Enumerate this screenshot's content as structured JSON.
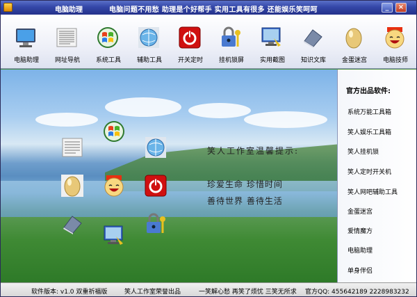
{
  "titlebar": {
    "title": "电脑助理",
    "slogan": "电脑问题不用愁  助理是个好帮手  实用工具有很多  还能娱乐笑呵呵",
    "minimize": "_",
    "close": "×"
  },
  "toolbar": {
    "items": [
      {
        "label": "电脑助理",
        "icon": "monitor-icon"
      },
      {
        "label": "网址导航",
        "icon": "document-icon"
      },
      {
        "label": "系统工具",
        "icon": "windows-logo-icon"
      },
      {
        "label": "辅助工具",
        "icon": "globe-icon"
      },
      {
        "label": "开关定时",
        "icon": "power-icon"
      },
      {
        "label": "挂机锁屏",
        "icon": "lock-key-icon"
      },
      {
        "label": "实用截图",
        "icon": "screen-capture-icon"
      },
      {
        "label": "知识文库",
        "icon": "book-icon"
      },
      {
        "label": "金蛋迷宫",
        "icon": "golden-egg-icon"
      },
      {
        "label": "电脑技师",
        "icon": "smiley-face-icon"
      }
    ]
  },
  "main": {
    "tip_title": "笑人工作室温馨提示:",
    "tip_line1": "珍爱生命   珍惜时间",
    "tip_line2": "善待世界   善待生活",
    "colors": {
      "red": "#d01010",
      "green": "#3a9a2a",
      "blue": "#2a6ad0",
      "gold": "#e8c878"
    }
  },
  "sidepanel": {
    "title": "官方出品软件:",
    "items": [
      "系统万能工具箱",
      "笑人娱乐工具箱",
      "笑人挂机锁",
      "笑人定时开关机",
      "笑人网吧辅助工具",
      "金蛋迷宫",
      "爱情魔方",
      "电脑助理",
      "单身伴侣"
    ]
  },
  "statusbar": {
    "version": "软件版本: v1.0  双重祈福版",
    "studio": "笑人工作室荣誉出品",
    "motto": "一笑解心愁  再笑了烦忧  三笑无所求",
    "contact": "官方QQ: 455642189  2228983232"
  }
}
